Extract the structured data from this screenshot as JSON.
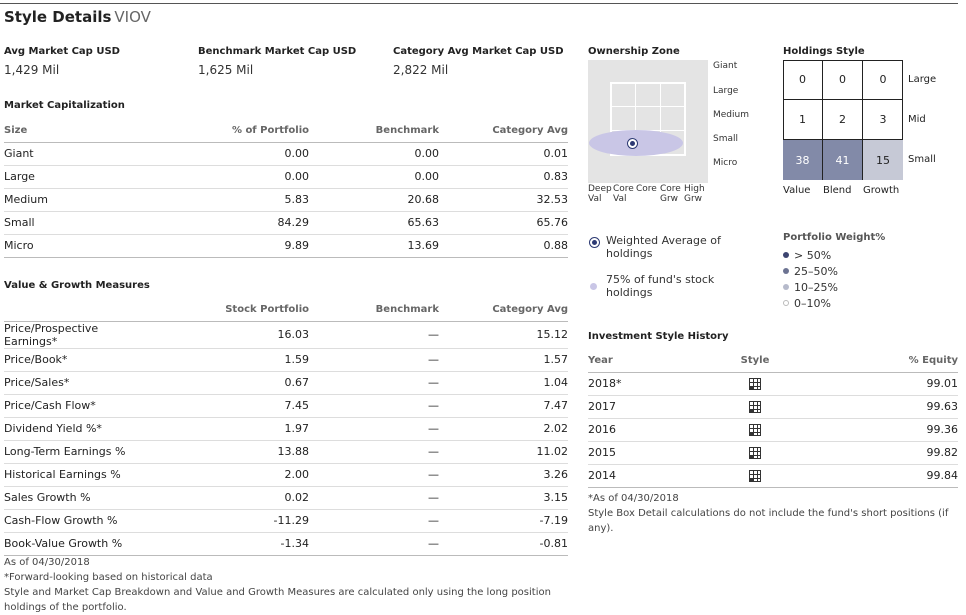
{
  "header": {
    "title": "Style Details",
    "ticker": "VIOV"
  },
  "summary": [
    {
      "label": "Avg Market Cap USD",
      "value": "1,429 Mil"
    },
    {
      "label": "Benchmark Market Cap USD",
      "value": "1,625 Mil"
    },
    {
      "label": "Category Avg Market Cap USD",
      "value": "2,822 Mil"
    }
  ],
  "market_cap": {
    "title": "Market Capitalization",
    "columns": [
      "Size",
      "% of Portfolio",
      "Benchmark",
      "Category Avg"
    ],
    "rows": [
      [
        "Giant",
        "0.00",
        "0.00",
        "0.01"
      ],
      [
        "Large",
        "0.00",
        "0.00",
        "0.83"
      ],
      [
        "Medium",
        "5.83",
        "20.68",
        "32.53"
      ],
      [
        "Small",
        "84.29",
        "65.63",
        "65.76"
      ],
      [
        "Micro",
        "9.89",
        "13.69",
        "0.88"
      ]
    ]
  },
  "value_growth": {
    "title": "Value & Growth Measures",
    "columns": [
      "",
      "Stock Portfolio",
      "Benchmark",
      "Category Avg"
    ],
    "rows": [
      [
        "Price/Prospective Earnings*",
        "16.03",
        "—",
        "15.12"
      ],
      [
        "Price/Book*",
        "1.59",
        "—",
        "1.57"
      ],
      [
        "Price/Sales*",
        "0.67",
        "—",
        "1.04"
      ],
      [
        "Price/Cash Flow*",
        "7.45",
        "—",
        "7.47"
      ],
      [
        "Dividend Yield %*",
        "1.97",
        "—",
        "2.02"
      ],
      [
        "Long-Term Earnings %",
        "13.88",
        "—",
        "11.02"
      ],
      [
        "Historical Earnings %",
        "2.00",
        "—",
        "3.26"
      ],
      [
        "Sales Growth %",
        "0.02",
        "—",
        "3.15"
      ],
      [
        "Cash-Flow Growth %",
        "-11.29",
        "—",
        "-7.19"
      ],
      [
        "Book-Value Growth %",
        "-1.34",
        "—",
        "-0.81"
      ]
    ]
  },
  "footnotes": {
    "as_of": "As of 04/30/2018",
    "forward": "*Forward-looking based on historical data",
    "style_note": "Style and Market Cap Breakdown and Value and Growth Measures are calculated only using the long position holdings of the portfolio."
  },
  "ownership_zone": {
    "title": "Ownership Zone",
    "row_labels": [
      "Giant",
      "Large",
      "Medium",
      "Small",
      "Micro"
    ],
    "col_labels": [
      [
        "Deep",
        "Val"
      ],
      [
        "Core",
        "Val"
      ],
      [
        "Core",
        ""
      ],
      [
        "Core",
        "Grw"
      ],
      [
        "High",
        "Grw"
      ]
    ],
    "legend_weighted": "Weighted Average of holdings",
    "legend_fund": "75% of fund's stock holdings",
    "colors": {
      "zone": "#c9c6e6",
      "centroid": "#2d3a73",
      "background": "#e4e4e4"
    }
  },
  "holdings_style": {
    "title": "Holdings Style",
    "cells": [
      [
        "0",
        "0",
        "0"
      ],
      [
        "1",
        "2",
        "3"
      ],
      [
        "38",
        "41",
        "15"
      ]
    ],
    "row_labels": [
      "Large",
      "Mid",
      "Small"
    ],
    "col_labels": [
      "Value",
      "Blend",
      "Growth"
    ]
  },
  "portfolio_weight": {
    "title": "Portfolio Weight%",
    "items": [
      {
        "label": "> 50%",
        "color": "#3c4470"
      },
      {
        "label": "25–50%",
        "color": "#6c7392"
      },
      {
        "label": "10–25%",
        "color": "#b6bacb"
      },
      {
        "label": "0–10%",
        "color": "#ffffff"
      }
    ]
  },
  "style_history": {
    "title": "Investment Style History",
    "columns": [
      "Year",
      "Style",
      "% Equity"
    ],
    "rows": [
      {
        "year": "2018*",
        "style_icon": "style-box-icon",
        "equity": "99.01"
      },
      {
        "year": "2017",
        "style_icon": "style-box-icon",
        "equity": "99.63"
      },
      {
        "year": "2016",
        "style_icon": "style-box-icon",
        "equity": "99.36"
      },
      {
        "year": "2015",
        "style_icon": "style-box-icon",
        "equity": "99.82"
      },
      {
        "year": "2014",
        "style_icon": "style-box-icon",
        "equity": "99.84"
      }
    ],
    "as_of": "*As of 04/30/2018",
    "note": "Style Box Detail calculations do not include the fund's short positions (if any)."
  }
}
